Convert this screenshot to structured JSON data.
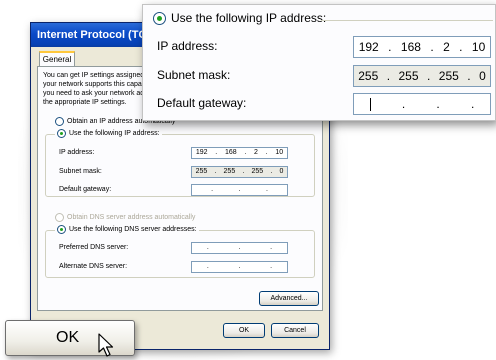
{
  "dialog": {
    "title": "Internet Protocol (TCP/IP) Properties",
    "tab_general": "General",
    "info_text": "You can get IP settings assigned automatically if your network supports this capability. Otherwise, you need to ask your network administrator for the appropriate IP settings.",
    "obtain_ip_auto": "Obtain an IP address automatically",
    "use_following_ip": "Use the following IP address:",
    "ip_address_label": "IP address:",
    "ip_address": [
      "192",
      "168",
      "2",
      "10"
    ],
    "subnet_label": "Subnet mask:",
    "subnet": [
      "255",
      "255",
      "255",
      "0"
    ],
    "gateway_label": "Default gateway:",
    "gateway": [
      "",
      "",
      "",
      ""
    ],
    "obtain_dns_auto": "Obtain DNS server address automatically",
    "use_following_dns": "Use the following DNS server addresses:",
    "preferred_dns_label": "Preferred DNS server:",
    "alternate_dns_label": "Alternate DNS server:",
    "advanced_button": "Advanced...",
    "ok_button": "OK",
    "cancel_button": "Cancel"
  },
  "zoom": {
    "use_following_ip": "Use the following IP address:",
    "ip_address_label": "IP address:",
    "ip_address": [
      "192",
      "168",
      "2",
      "10"
    ],
    "subnet_label": "Subnet mask:",
    "subnet": [
      "255",
      "255",
      "255",
      "0"
    ],
    "gateway_label": "Default gateway:"
  },
  "big_ok": {
    "label": "OK"
  },
  "colors": {
    "titlebar": "#0a4ac8",
    "dialog_bg": "#ece9d8",
    "radio_dot": "#21a121"
  }
}
